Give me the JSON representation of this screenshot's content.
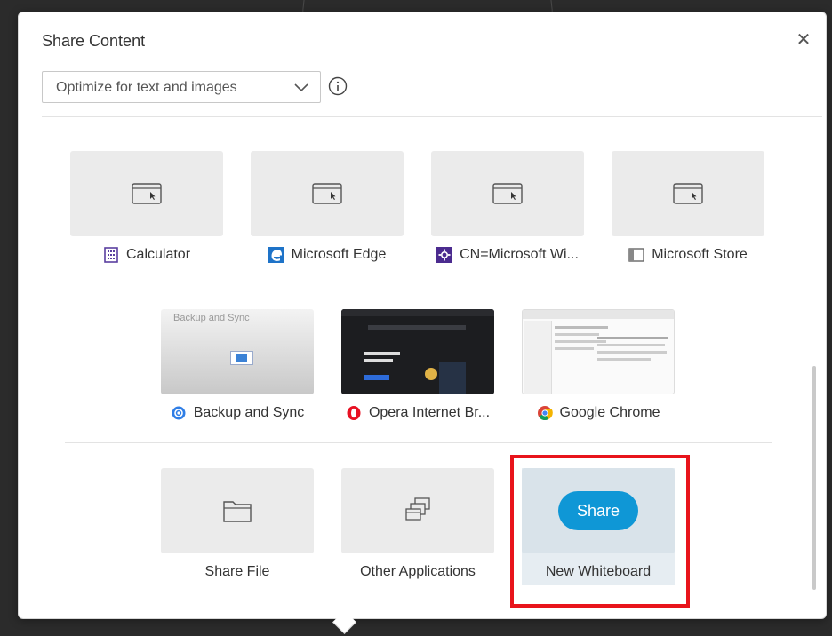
{
  "dialog": {
    "title": "Share Content",
    "close_icon": "close-icon",
    "quality_select": {
      "value": "Optimize for text and images",
      "icon": "chevron-down-icon"
    },
    "info_icon": "info-icon"
  },
  "windows": [
    {
      "label": "Calculator",
      "icon": "calculator-icon",
      "preview": "window-icon"
    },
    {
      "label": "Microsoft Edge",
      "icon": "edge-icon",
      "preview": "window-icon"
    },
    {
      "label": "CN=Microsoft Wi...",
      "icon": "app-icon",
      "preview": "window-icon"
    },
    {
      "label": "Microsoft Store",
      "icon": "store-icon",
      "preview": "window-icon"
    }
  ],
  "live_windows": [
    {
      "label": "Backup and Sync",
      "icon": "backup-sync-icon",
      "thumb_text": "Backup and Sync"
    },
    {
      "label": "Opera Internet Br...",
      "icon": "opera-icon"
    },
    {
      "label": "Google Chrome",
      "icon": "chrome-icon"
    }
  ],
  "other": [
    {
      "label": "Share File",
      "icon": "folder-icon"
    },
    {
      "label": "Other Applications",
      "icon": "stacked-windows-icon"
    },
    {
      "label": "New Whiteboard",
      "button": "Share"
    }
  ],
  "colors": {
    "accent": "#0f97d6",
    "highlight": "#e8141b"
  }
}
